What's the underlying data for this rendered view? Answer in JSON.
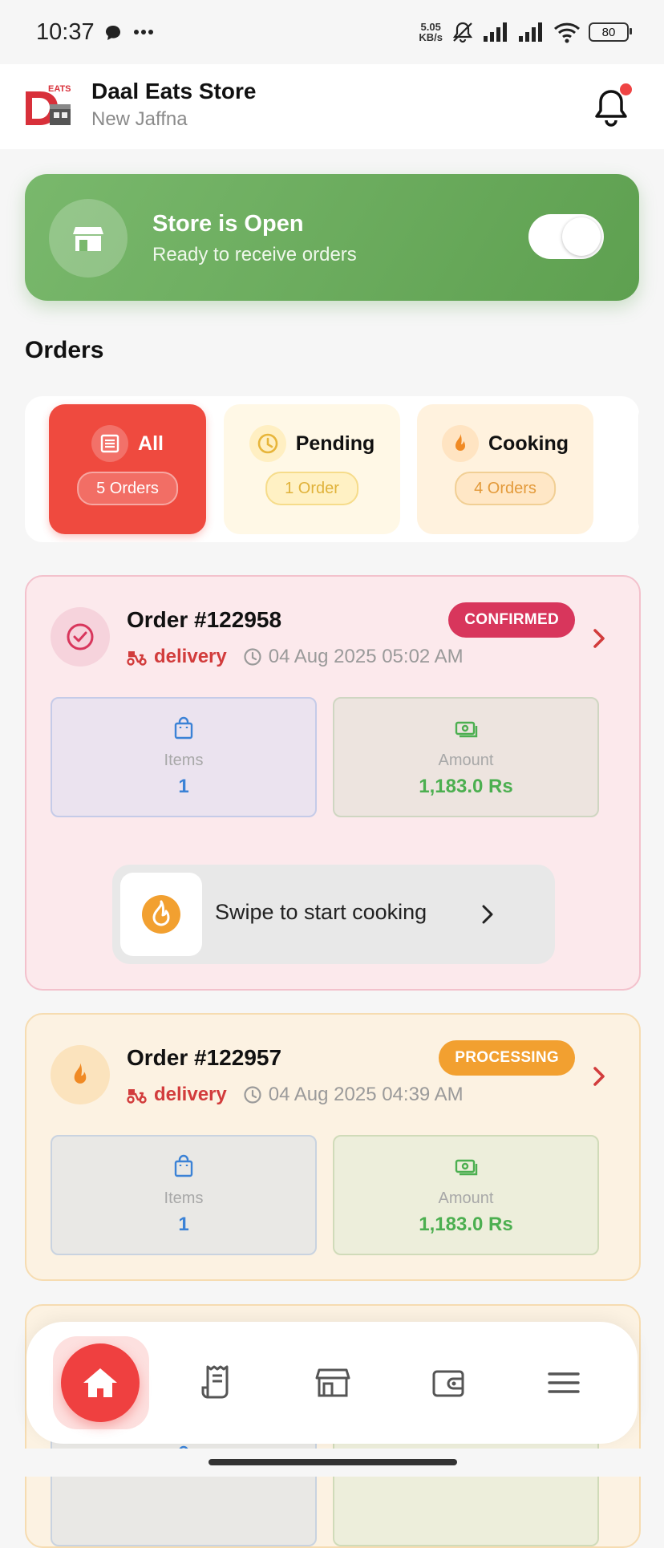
{
  "status_bar": {
    "time": "10:37",
    "net_speed_value": "5.05",
    "net_speed_unit": "KB/s",
    "battery": "80",
    "icons": [
      "chat-icon",
      "more-icon",
      "mute-icon",
      "signal-icon",
      "signal-icon",
      "wifi-icon",
      "battery-icon"
    ]
  },
  "header": {
    "logo_text": "EATS",
    "store_name": "Daal Eats Store",
    "location": "New Jaffna",
    "has_notification": true
  },
  "store_status": {
    "title": "Store is Open",
    "subtitle": "Ready to receive orders",
    "is_open": true,
    "icon": "store-icon"
  },
  "orders_section": {
    "title": "Orders"
  },
  "filters": [
    {
      "label": "All",
      "count": "5 Orders",
      "icon": "list-icon",
      "active": true
    },
    {
      "label": "Pending",
      "count": "1 Order",
      "icon": "clock-icon",
      "active": false
    },
    {
      "label": "Cooking",
      "count": "4 Orders",
      "icon": "flame-icon",
      "active": false
    }
  ],
  "orders": [
    {
      "number": "Order #122958",
      "status": "CONFIRMED",
      "type": "delivery",
      "date": "04 Aug 2025 05:02 AM",
      "items_label": "Items",
      "items_value": "1",
      "amount_label": "Amount",
      "amount_value": "1,183.0 Rs",
      "action": "Swipe to start cooking"
    },
    {
      "number": "Order #122957",
      "status": "PROCESSING",
      "type": "delivery",
      "date": "04 Aug 2025 04:39 AM",
      "items_label": "Items",
      "items_value": "1",
      "amount_label": "Amount",
      "amount_value": "1,183.0 Rs"
    }
  ],
  "bottom_nav": [
    "home-icon",
    "receipt-icon",
    "store-icon",
    "wallet-icon",
    "menu-icon"
  ],
  "colors": {
    "accent": "#ef4040",
    "store_open": "#6aad5c",
    "confirmed": "#d8365c",
    "processing": "#f2a030"
  }
}
